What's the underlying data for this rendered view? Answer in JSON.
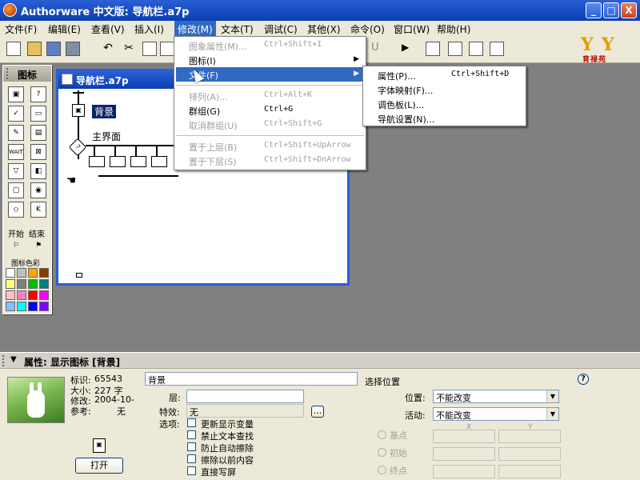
{
  "window": {
    "title": "Authorware 中文版: 导航栏.a7p",
    "controls": [
      "_",
      "□",
      "X"
    ]
  },
  "menubar": [
    {
      "label": "文件(F)"
    },
    {
      "label": "编辑(E)"
    },
    {
      "label": "查看(V)"
    },
    {
      "label": "插入(I)"
    },
    {
      "label": "修改(M)"
    },
    {
      "label": "文本(T)"
    },
    {
      "label": "调试(C)"
    },
    {
      "label": "其他(X)"
    },
    {
      "label": "命令(O)"
    },
    {
      "label": "窗口(W)"
    },
    {
      "label": "帮助(H)"
    }
  ],
  "toolbar": {
    "underline_label": "U",
    "logo_letters": "YY",
    "logo_text": "育禄苑"
  },
  "icon_palette": {
    "title": "图标",
    "start_label": "开始",
    "end_label": "结束",
    "color_label": "图标色彩",
    "icons": [
      "display-icon",
      "motion-icon",
      "erase-icon",
      "wait-icon",
      "navigate-icon",
      "framework-icon",
      "decision-icon",
      "interaction-icon",
      "calculation-icon",
      "map-icon",
      "digital-movie-icon",
      "sound-icon",
      "dvd-icon",
      "knowledge-object-icon",
      "start-flag-icon",
      "stop-flag-icon"
    ],
    "swatches": [
      "#ffffff",
      "#c0c0c0",
      "#ffa500",
      "#804000",
      "#ffff80",
      "#808080",
      "#00c000",
      "#008080",
      "#ffc0c0",
      "#ff80c0",
      "#ff0000",
      "#ff00ff",
      "#80c0ff",
      "#00ffff",
      "#0000ff",
      "#8000ff"
    ]
  },
  "flow_window": {
    "title": "导航栏.a7p",
    "display_label": "背景",
    "framework_label": "主界面",
    "wait_label": "WAIT"
  },
  "modify_menu": {
    "items": [
      {
        "label": "图象属性(M)...",
        "shortcut": "Ctrl+Shift+I",
        "disabled": true
      },
      {
        "label": "图标(I)",
        "shortcut": "",
        "submenu": true
      },
      {
        "label": "文件(F)",
        "shortcut": "",
        "submenu": true,
        "highlighted": true
      },
      {
        "label": "排列(A)...",
        "shortcut": "Ctrl+Alt+K",
        "disabled": true
      },
      {
        "label": "群组(G)",
        "shortcut": "Ctrl+G"
      },
      {
        "label": "取消群组(U)",
        "shortcut": "Ctrl+Shift+G",
        "disabled": true
      },
      {
        "label": "置于上层(B)",
        "shortcut": "Ctrl+Shift+UpArrow",
        "disabled": true
      },
      {
        "label": "置于下层(S)",
        "shortcut": "Ctrl+Shift+DnArrow",
        "disabled": true
      }
    ]
  },
  "file_submenu": {
    "items": [
      {
        "label": "属性(P)...",
        "shortcut": "Ctrl+Shift+D"
      },
      {
        "label": "字体映射(F)...",
        "shortcut": ""
      },
      {
        "label": "调色板(L)...",
        "shortcut": ""
      },
      {
        "label": "导航设置(N)...",
        "shortcut": ""
      }
    ]
  },
  "properties": {
    "header": "属性: 显示图标 [背景]",
    "id_label": "标识:",
    "id_value": "65543",
    "size_label": "大小:",
    "size_value": "227 字",
    "modified_label": "修改:",
    "modified_value": "2004-10-",
    "ref_label": "参考:",
    "ref_value": "无",
    "open_button": "打开",
    "name_value": "背景",
    "layer_label": "层:",
    "layer_value": "",
    "effect_label": "特效:",
    "effect_value": "无",
    "effect_button": "...",
    "options_label": "选项:",
    "options": [
      {
        "label": "更新显示变量",
        "checked": false
      },
      {
        "label": "禁止文本查找",
        "checked": false
      },
      {
        "label": "防止自动擦除",
        "checked": false
      },
      {
        "label": "擦除以前内容",
        "checked": false
      },
      {
        "label": "直接写屏",
        "checked": false
      }
    ],
    "select_position_label": "选择位置",
    "position_label": "位置:",
    "position_value": "不能改变",
    "movable_label": "活动:",
    "movable_value": "不能改变",
    "base_label": "基点",
    "init_label": "初始",
    "end_label": "终点",
    "x_label": "X",
    "y_label": "Y",
    "help": "?"
  }
}
